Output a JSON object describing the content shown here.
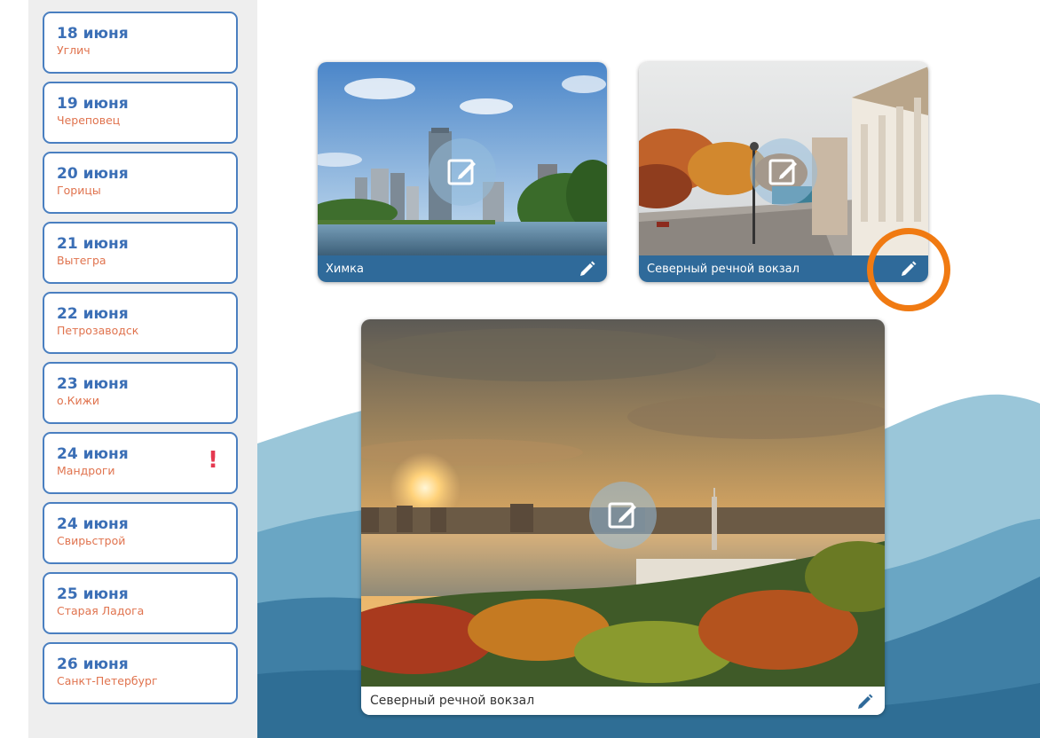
{
  "sidebar": {
    "days": [
      {
        "date": "18 июня",
        "city": "Углич",
        "warning": ""
      },
      {
        "date": "19 июня",
        "city": "Череповец",
        "warning": ""
      },
      {
        "date": "20 июня",
        "city": "Горицы",
        "warning": ""
      },
      {
        "date": "21 июня",
        "city": "Вытегра",
        "warning": ""
      },
      {
        "date": "22 июня",
        "city": "Петрозаводск",
        "warning": ""
      },
      {
        "date": "23 июня",
        "city": "о.Кижи",
        "warning": ""
      },
      {
        "date": "24 июня",
        "city": "Мандроги",
        "warning": "!"
      },
      {
        "date": "24 июня",
        "city": "Свирьстрой",
        "warning": ""
      },
      {
        "date": "25 июня",
        "city": "Старая Ладога",
        "warning": ""
      },
      {
        "date": "26 июня",
        "city": "Санкт-Петербург",
        "warning": ""
      }
    ]
  },
  "cards": {
    "small1": {
      "caption": "Химка",
      "image": "khimki-river-skyline"
    },
    "small2": {
      "caption": "Северный речной вокзал",
      "image": "river-station-autumn-colonnade"
    },
    "big": {
      "caption": "Северный речной вокзал",
      "image": "river-station-sunset-aerial"
    }
  },
  "colors": {
    "accent": "#3b6fb6",
    "city": "#e0734e",
    "warning": "#e53950",
    "caption_bar": "#2f6a9a",
    "highlight": "#f07a12",
    "wave_light": "#9ac6d9",
    "wave_dark": "#3f7fa5"
  }
}
